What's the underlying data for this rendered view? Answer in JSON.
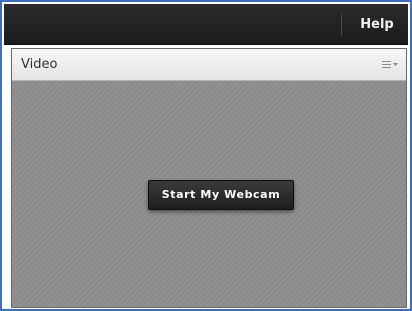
{
  "menubar": {
    "help_label": "Help"
  },
  "pod": {
    "title": "Video",
    "menu_icon": "menu-lines-icon",
    "start_webcam_label": "Start My Webcam"
  },
  "colors": {
    "window_border": "#3f6fb6",
    "menubar_bg": "#222222",
    "pod_body_bg": "#8e8e8e",
    "button_bg": "#262626"
  }
}
